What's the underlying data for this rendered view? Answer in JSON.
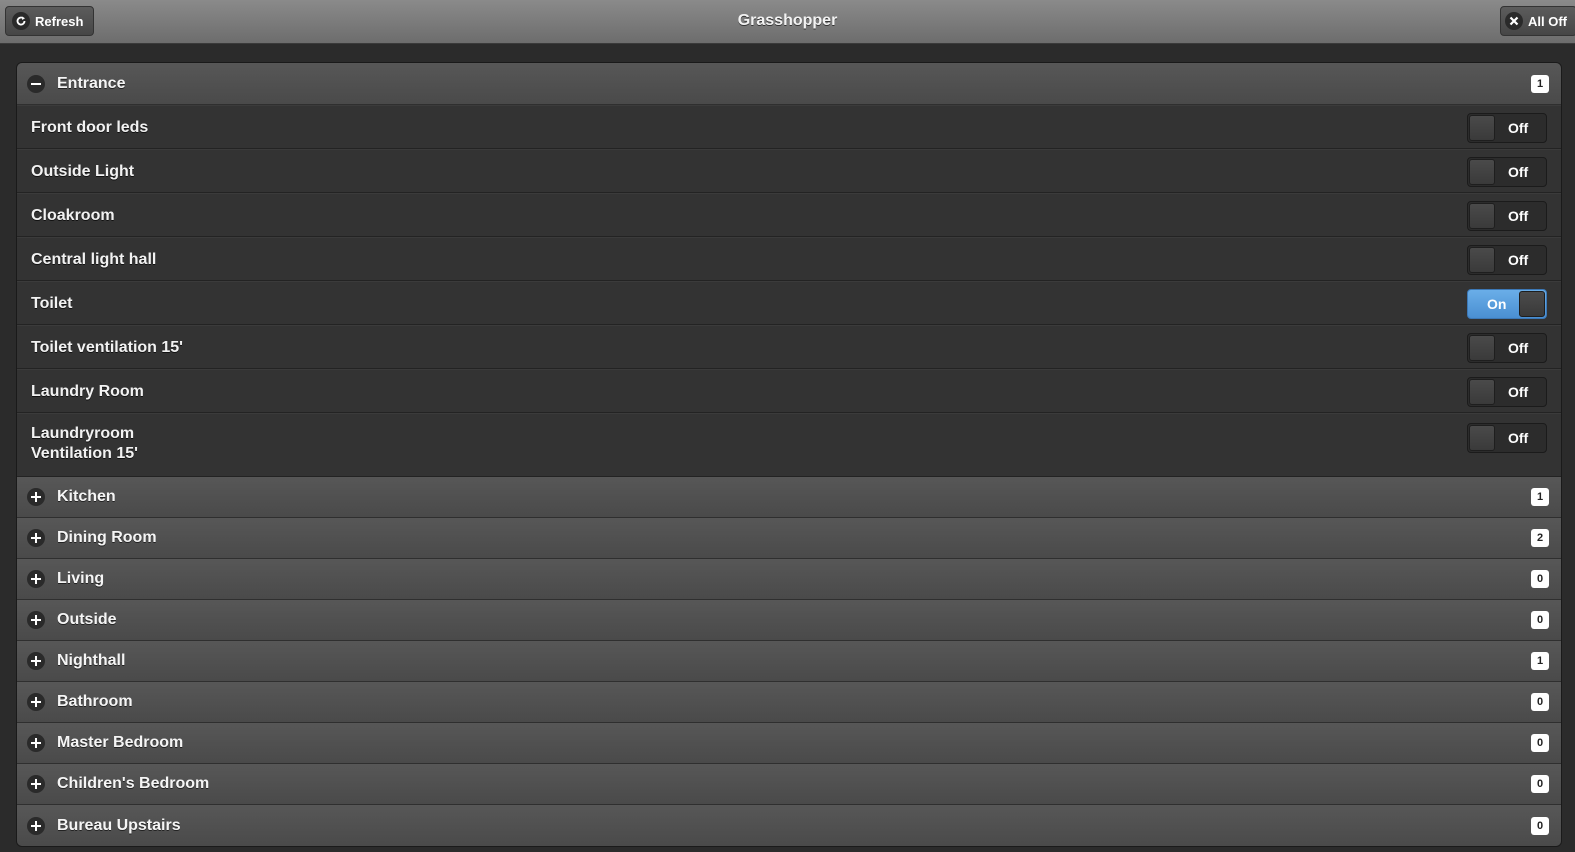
{
  "header": {
    "title": "Grasshopper",
    "refresh_label": "Refresh",
    "all_off_label": "All Off"
  },
  "entrance": {
    "title": "Entrance",
    "count": "1",
    "items": [
      {
        "label": "Front door leds",
        "state": "Off"
      },
      {
        "label": "Outside Light",
        "state": "Off"
      },
      {
        "label": "Cloakroom",
        "state": "Off"
      },
      {
        "label": "Central light hall",
        "state": "Off"
      },
      {
        "label": "Toilet",
        "state": "On"
      },
      {
        "label": "Toilet ventilation 15'",
        "state": "Off"
      },
      {
        "label": "Laundry Room",
        "state": "Off"
      },
      {
        "label_line1": "Laundryroom",
        "label_line2": "Ventilation 15'",
        "state": "Off"
      }
    ]
  },
  "sections": [
    {
      "title": "Kitchen",
      "count": "1"
    },
    {
      "title": "Dining Room",
      "count": "2"
    },
    {
      "title": "Living",
      "count": "0"
    },
    {
      "title": "Outside",
      "count": "0"
    },
    {
      "title": "Nighthall",
      "count": "1"
    },
    {
      "title": "Bathroom",
      "count": "0"
    },
    {
      "title": "Master Bedroom",
      "count": "0"
    },
    {
      "title": "Children's Bedroom",
      "count": "0"
    },
    {
      "title": "Bureau Upstairs",
      "count": "0"
    }
  ],
  "colors": {
    "on_accent": "#4a8fd2",
    "header_bg": "#7a7a7a"
  }
}
